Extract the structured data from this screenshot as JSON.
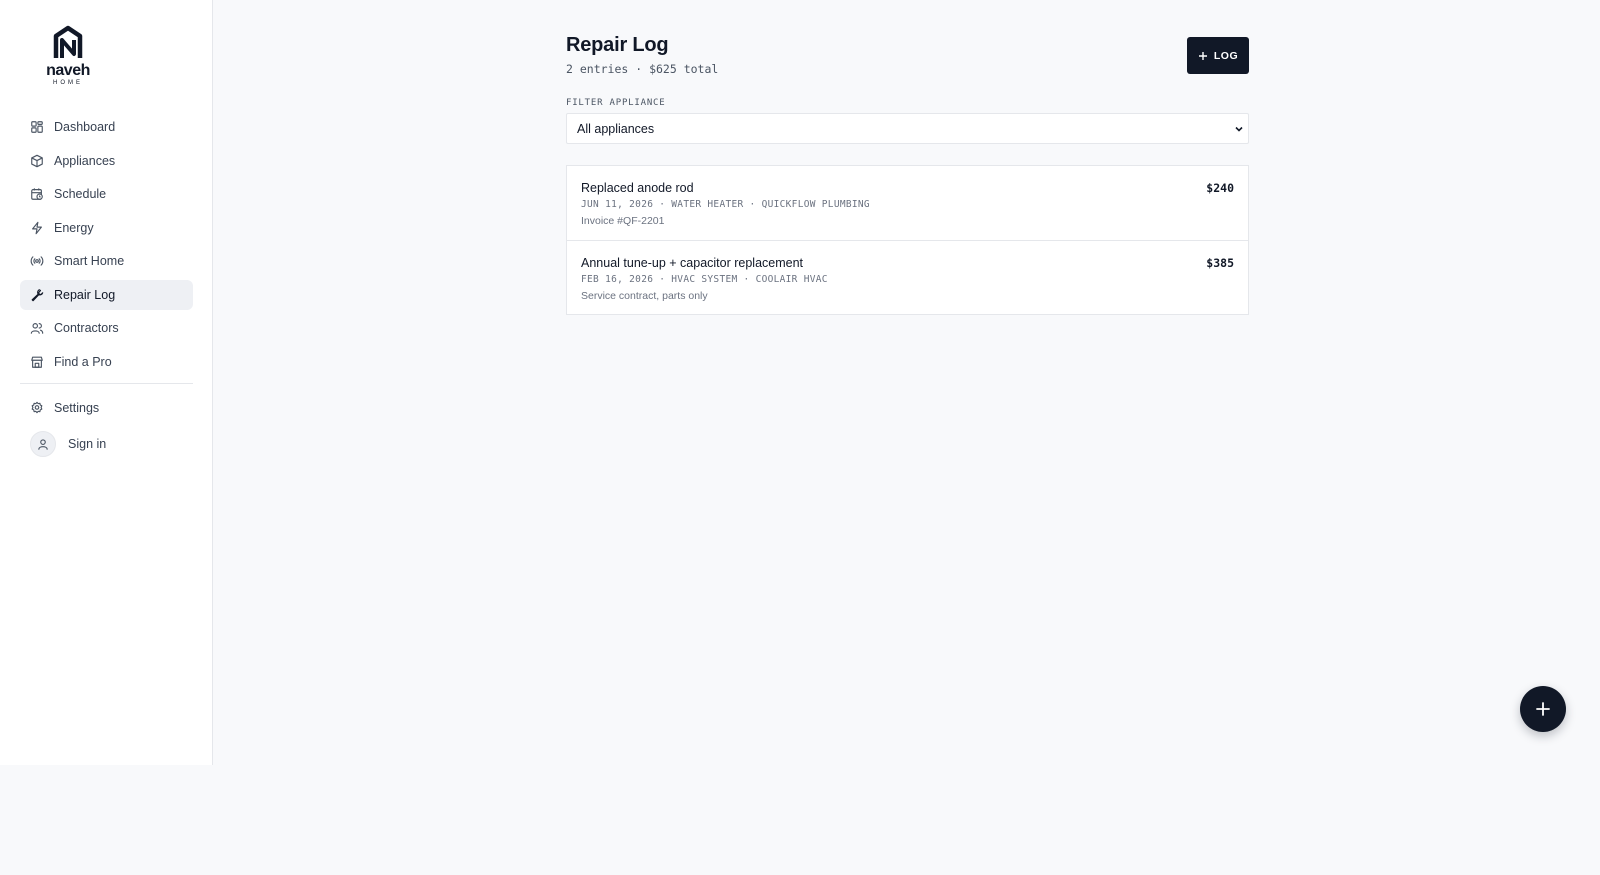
{
  "brand": {
    "name": "naveh",
    "tagline": "HOME"
  },
  "sidebar": {
    "items": [
      {
        "label": "Dashboard",
        "icon": "grid-icon"
      },
      {
        "label": "Appliances",
        "icon": "box-icon"
      },
      {
        "label": "Schedule",
        "icon": "calendar-clock-icon"
      },
      {
        "label": "Energy",
        "icon": "lightning-icon"
      },
      {
        "label": "Smart Home",
        "icon": "broadcast-icon"
      },
      {
        "label": "Repair Log",
        "icon": "wrench-icon",
        "active": true
      },
      {
        "label": "Contractors",
        "icon": "users-icon"
      },
      {
        "label": "Find a Pro",
        "icon": "store-icon"
      }
    ],
    "settings": {
      "label": "Settings",
      "icon": "gear-icon"
    },
    "signin": {
      "label": "Sign in",
      "icon": "user-icon"
    }
  },
  "header": {
    "title": "Repair Log",
    "subtitle": "2 entries · $625 total",
    "log_button": "LOG"
  },
  "filter": {
    "label": "FILTER APPLIANCE",
    "selected": "All appliances"
  },
  "entries": [
    {
      "title": "Replaced anode rod",
      "meta": "JUN 11, 2026 · WATER HEATER · QUICKFLOW PLUMBING",
      "note": "Invoice #QF-2201",
      "amount": "$240"
    },
    {
      "title": "Annual tune-up + capacitor replacement",
      "meta": "FEB 16, 2026 · HVAC SYSTEM · COOLAIR HVAC",
      "note": "Service contract, parts only",
      "amount": "$385"
    }
  ],
  "colors": {
    "accent": "#111827",
    "background": "#f8f9fb",
    "active_nav": "#eef0f4"
  }
}
